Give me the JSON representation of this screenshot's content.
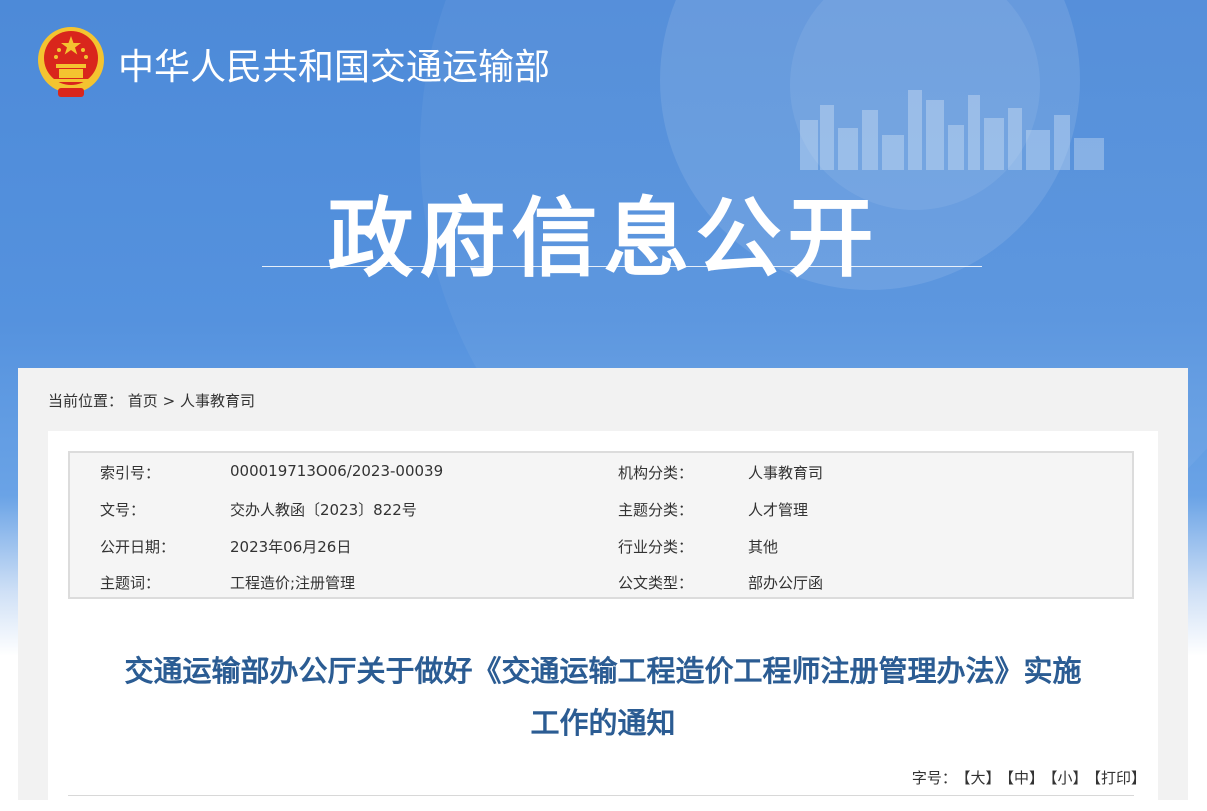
{
  "header": {
    "ministry_name": "中华人民共和国交通运输部",
    "section_title": "政府信息公开"
  },
  "breadcrumb": {
    "prefix": "当前位置：",
    "home": "首页",
    "separator": ">",
    "current": "人事教育司"
  },
  "meta": {
    "rows": [
      {
        "label1": "索引号：",
        "value1": "000019713O06/2023-00039",
        "label2": "机构分类：",
        "value2": "人事教育司"
      },
      {
        "label1": "文号：",
        "value1": "交办人教函〔2023〕822号",
        "label2": "主题分类：",
        "value2": "人才管理"
      },
      {
        "label1": "公开日期：",
        "value1": "2023年06月26日",
        "label2": "行业分类：",
        "value2": "其他"
      },
      {
        "label1": "主题词：",
        "value1": "工程造价;注册管理",
        "label2": "公文类型：",
        "value2": "部办公厅函"
      }
    ]
  },
  "document": {
    "title_line1": "交通运输部办公厅关于做好《交通运输工程造价工程师注册管理办法》实施",
    "title_line2": "工作的通知"
  },
  "font_size": {
    "label": "字号：",
    "large": "【大】",
    "medium": "【中】",
    "small": "【小】",
    "print": "【打印】"
  },
  "colors": {
    "banner_blue": "#4d8ad8",
    "title_blue": "#2b5c93",
    "emblem_red": "#d9261c",
    "emblem_gold": "#f4c430"
  }
}
